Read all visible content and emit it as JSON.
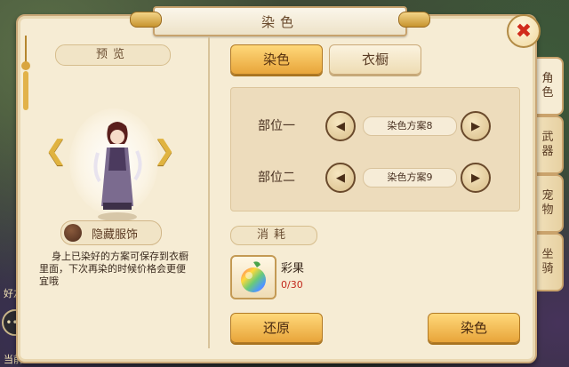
{
  "window": {
    "title": "染色",
    "close_icon": "close-x-icon"
  },
  "preview": {
    "label": "预览",
    "hide_label": "隐藏服饰",
    "hint": "身上已染好的方案可保存到衣橱里面，下次再染的时候价格会更便宜哦"
  },
  "tabs": {
    "dye": "染色",
    "wardrobe": "衣橱"
  },
  "parts": [
    {
      "label": "部位一",
      "scheme": "染色方案8"
    },
    {
      "label": "部位二",
      "scheme": "染色方案9"
    }
  ],
  "consume": {
    "label": "消耗",
    "item_name": "彩果",
    "item_count": "0/30"
  },
  "actions": {
    "restore": "还原",
    "dye": "染色"
  },
  "side_tabs": [
    "角色",
    "武器",
    "宠物",
    "坐骑"
  ],
  "scene": {
    "left_top_text": "好友",
    "left_bottom_text": "当前"
  },
  "colors": {
    "accent": "#e8a53a",
    "panel": "#f6ecd4",
    "count_red": "#c2281c"
  }
}
